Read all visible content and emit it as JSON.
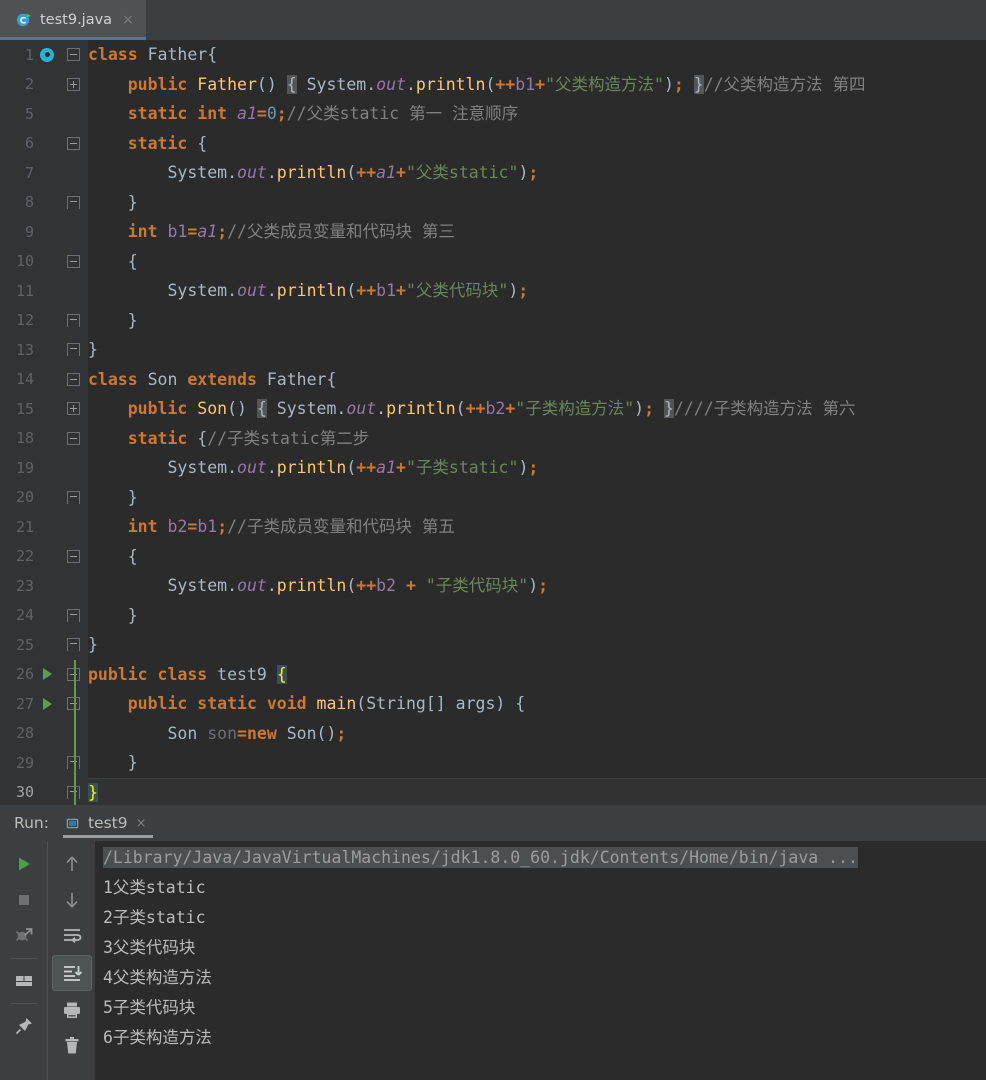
{
  "window": {
    "app": "IntelliJ IDEA",
    "theme_bg": "#2b2b2b",
    "panel_bg": "#3c3f41",
    "accent": "#3d7ab8"
  },
  "editor_tabs": [
    {
      "label": "test9.java",
      "icon": "java-class-runnable-icon",
      "close": "×",
      "active": true
    }
  ],
  "editor": {
    "lines": [
      {
        "no": "1",
        "text": "class Father{"
      },
      {
        "no": "2",
        "text": "    public Father() { System.out.println(++b1+\"父类构造方法\"); }//父类构造方法 第四"
      },
      {
        "no": "5",
        "text": "    static int a1=0;//父类static 第一 注意顺序"
      },
      {
        "no": "6",
        "text": "    static {"
      },
      {
        "no": "7",
        "text": "        System.out.println(++a1+\"父类static\");"
      },
      {
        "no": "8",
        "text": "    }"
      },
      {
        "no": "9",
        "text": "    int b1=a1;//父类成员变量和代码块 第三"
      },
      {
        "no": "10",
        "text": "    {"
      },
      {
        "no": "11",
        "text": "        System.out.println(++b1+\"父类代码块\");"
      },
      {
        "no": "12",
        "text": "    }"
      },
      {
        "no": "13",
        "text": "}"
      },
      {
        "no": "14",
        "text": "class Son extends Father{"
      },
      {
        "no": "15",
        "text": "    public Son() { System.out.println(++b2+\"子类构造方法\"); }////子类构造方法 第六"
      },
      {
        "no": "18",
        "text": "    static {//子类static第二步"
      },
      {
        "no": "19",
        "text": "        System.out.println(++a1+\"子类static\");"
      },
      {
        "no": "20",
        "text": "    }"
      },
      {
        "no": "21",
        "text": "    int b2=b1;//子类成员变量和代码块 第五"
      },
      {
        "no": "22",
        "text": "    {"
      },
      {
        "no": "23",
        "text": "        System.out.println(++b2 + \"子类代码块\");"
      },
      {
        "no": "24",
        "text": "    }"
      },
      {
        "no": "25",
        "text": "}"
      },
      {
        "no": "26",
        "text": "public class test9 {"
      },
      {
        "no": "27",
        "text": "    public static void main(String[] args) {"
      },
      {
        "no": "28",
        "text": "        Son son=new Son();"
      },
      {
        "no": "29",
        "text": "    }"
      },
      {
        "no": "30",
        "text": "}"
      }
    ],
    "caret_line": "30",
    "gutter_run_lines": [
      "26",
      "27"
    ],
    "implemented_marker_line": "1",
    "colors": {
      "keyword": "#cc7832",
      "string": "#6a8759",
      "comment": "#808080",
      "number": "#6897bb",
      "field": "#9876aa",
      "method": "#ffc66d",
      "identifier": "#a9b7c6"
    }
  },
  "run_window": {
    "title": "Run:",
    "tab": {
      "label": "test9",
      "close": "×",
      "icon": "run-configuration-icon"
    },
    "left_tools": [
      {
        "name": "rerun-button",
        "icon": "green-play-icon"
      },
      {
        "name": "stop-button",
        "icon": "stop-square-icon"
      },
      {
        "name": "rerun-failed-tests-button",
        "icon": "rerun-failed-icon"
      },
      {
        "name": "layout-settings-button",
        "icon": "layout-icon"
      },
      {
        "name": "pin-tab-button",
        "icon": "pin-icon"
      }
    ],
    "right_tools": [
      {
        "name": "up-button",
        "icon": "arrow-up-icon"
      },
      {
        "name": "down-button",
        "icon": "arrow-down-icon"
      },
      {
        "name": "soft-wrap-button",
        "icon": "soft-wrap-icon"
      },
      {
        "name": "scroll-to-end-button",
        "icon": "scroll-to-end-icon",
        "selected": true
      },
      {
        "name": "print-button",
        "icon": "printer-icon"
      },
      {
        "name": "clear-all-button",
        "icon": "trash-icon"
      }
    ],
    "console_lines": [
      {
        "text": "/Library/Java/JavaVirtualMachines/jdk1.8.0_60.jdk/Contents/Home/bin/java ...",
        "highlighted": true
      },
      {
        "text": "1父类static",
        "highlighted": false
      },
      {
        "text": "2子类static",
        "highlighted": false
      },
      {
        "text": "3父类代码块",
        "highlighted": false
      },
      {
        "text": "4父类构造方法",
        "highlighted": false
      },
      {
        "text": "5子类代码块",
        "highlighted": false
      },
      {
        "text": "6子类构造方法",
        "highlighted": false
      }
    ]
  }
}
